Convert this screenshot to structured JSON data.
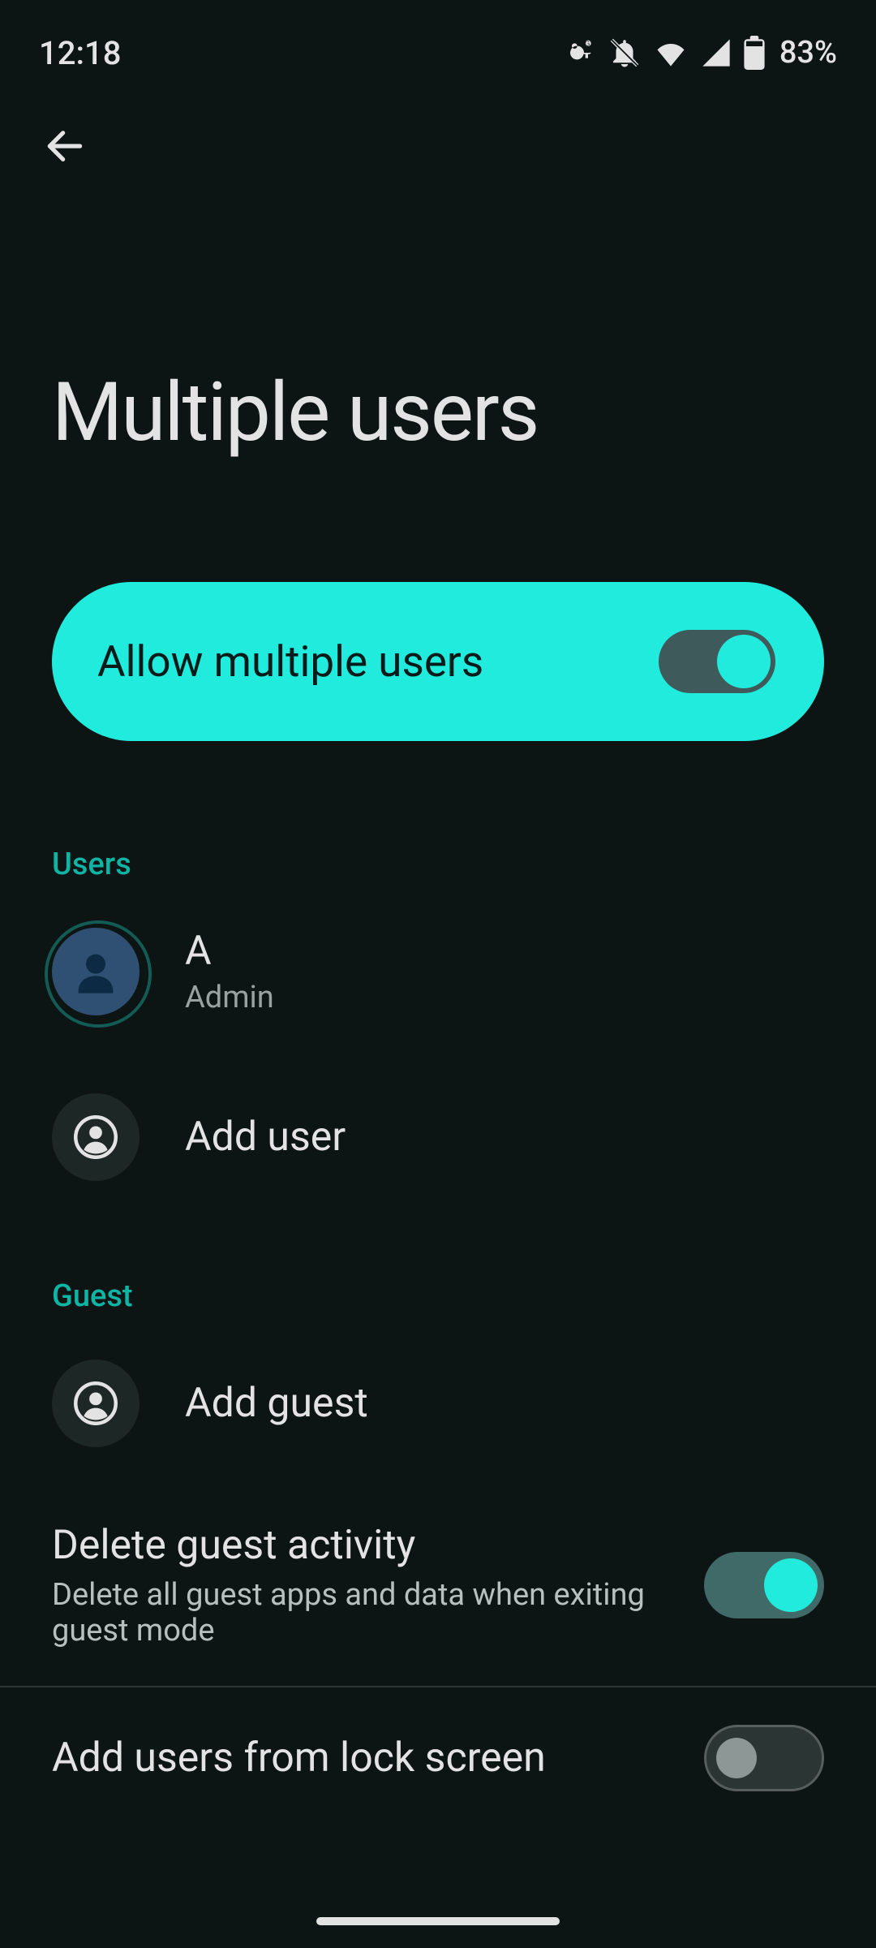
{
  "status": {
    "time": "12:18",
    "battery_pct": "83%"
  },
  "page": {
    "title": "Multiple users"
  },
  "allow": {
    "label": "Allow multiple users",
    "on": true
  },
  "sections": {
    "users_header": "Users",
    "guest_header": "Guest"
  },
  "users": {
    "admin": {
      "name": "A",
      "role": "Admin"
    },
    "add_user_label": "Add user"
  },
  "guest": {
    "add_guest_label": "Add guest",
    "delete_activity": {
      "title": "Delete guest activity",
      "subtitle": "Delete all guest apps and data when exiting guest mode",
      "on": true
    }
  },
  "lockscreen": {
    "title": "Add users from lock screen",
    "on": false
  }
}
